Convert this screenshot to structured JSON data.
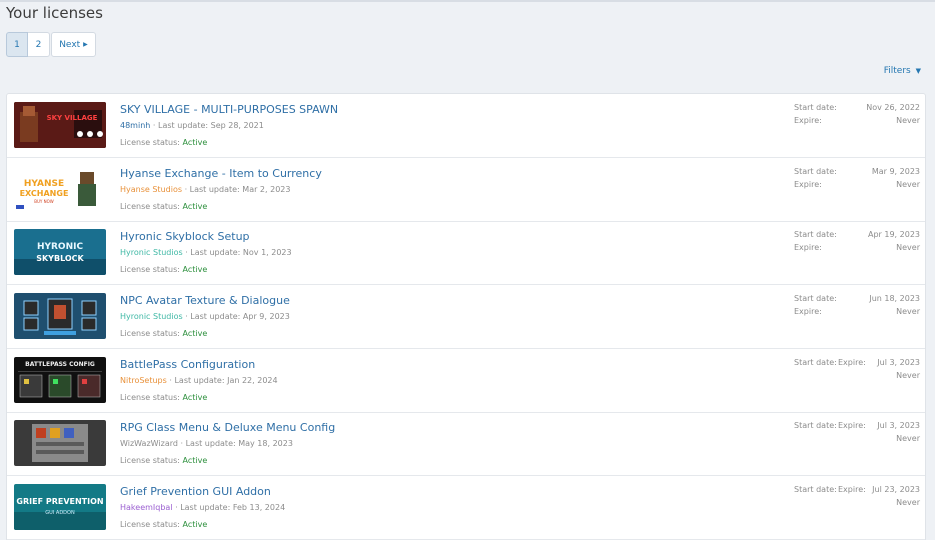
{
  "page": {
    "title": "Your licenses"
  },
  "pager": {
    "pages": [
      "1",
      "2"
    ],
    "current": "1",
    "next_label": "Next",
    "next_icon": "chevron-right-icon"
  },
  "filters": {
    "label": "Filters",
    "icon": "caret-down-icon"
  },
  "colors": {
    "link": "#2f6fa6",
    "active": "#2c8f3c",
    "author_orange": "#e8913a",
    "author_teal": "#3fb8a5",
    "author_purple": "#9b5fd1"
  },
  "licenses": [
    {
      "title": "SKY VILLAGE - MULTI-PURPOSES SPAWN",
      "author": "48minh",
      "author_color": "#2f6fa6",
      "last_update": "Last update: Sep 28, 2021",
      "status_label": "License status:",
      "status": "Active",
      "start_label": "Start date:",
      "start": "Nov 26, 2022",
      "expire_label": "Expire:",
      "expire": "Never",
      "thumb_text": "SKY VILLAGE"
    },
    {
      "title": "Hyanse Exchange - Item to Currency",
      "author": "Hyanse Studios",
      "author_color": "#e8913a",
      "last_update": "Last update: Mar 2, 2023",
      "status_label": "License status:",
      "status": "Active",
      "start_label": "Start date:",
      "start": "Mar 9, 2023",
      "expire_label": "Expire:",
      "expire": "Never",
      "thumb_text": "HYANSE EXCHANGE"
    },
    {
      "title": "Hyronic Skyblock Setup",
      "author": "Hyronic Studios",
      "author_color": "#3fb8a5",
      "last_update": "Last update: Nov 1, 2023",
      "status_label": "License status:",
      "status": "Active",
      "start_label": "Start date:",
      "start": "Apr 19, 2023",
      "expire_label": "Expire:",
      "expire": "Never",
      "thumb_text": "HYRONIC SKYBLOCK"
    },
    {
      "title": "NPC Avatar Texture & Dialogue",
      "author": "Hyronic Studios",
      "author_color": "#3fb8a5",
      "last_update": "Last update: Apr 9, 2023",
      "status_label": "License status:",
      "status": "Active",
      "start_label": "Start date:",
      "start": "Jun 18, 2023",
      "expire_label": "Expire:",
      "expire": "Never",
      "thumb_text": ""
    },
    {
      "title": "BattlePass Configuration",
      "author": "NitroSetups",
      "author_color": "#e8913a",
      "last_update": "Last update: Jan 22, 2024",
      "status_label": "License status:",
      "status": "Active",
      "start_label": "Start date:",
      "start": "Jul 3, 2023",
      "expire_label": "Expire:",
      "expire": "Never",
      "thumb_text": "BATTLEPASS CONFIG"
    },
    {
      "title": "RPG Class Menu & Deluxe Menu Config",
      "author": "WizWazWizard",
      "author_color": "#8c8c8c",
      "last_update": "Last update: May 18, 2023",
      "status_label": "License status:",
      "status": "Active",
      "start_label": "Start date:",
      "start": "Jul 3, 2023",
      "expire_label": "Expire:",
      "expire": "Never",
      "thumb_text": ""
    },
    {
      "title": "Grief Prevention GUI Addon",
      "author": "HakeemIqbal",
      "author_color": "#9b5fd1",
      "last_update": "Last update: Feb 13, 2024",
      "status_label": "License status:",
      "status": "Active",
      "start_label": "Start date:",
      "start": "Jul 23, 2023",
      "expire_label": "Expire:",
      "expire": "Never",
      "thumb_text": "GRIEF PREVENTION"
    }
  ]
}
